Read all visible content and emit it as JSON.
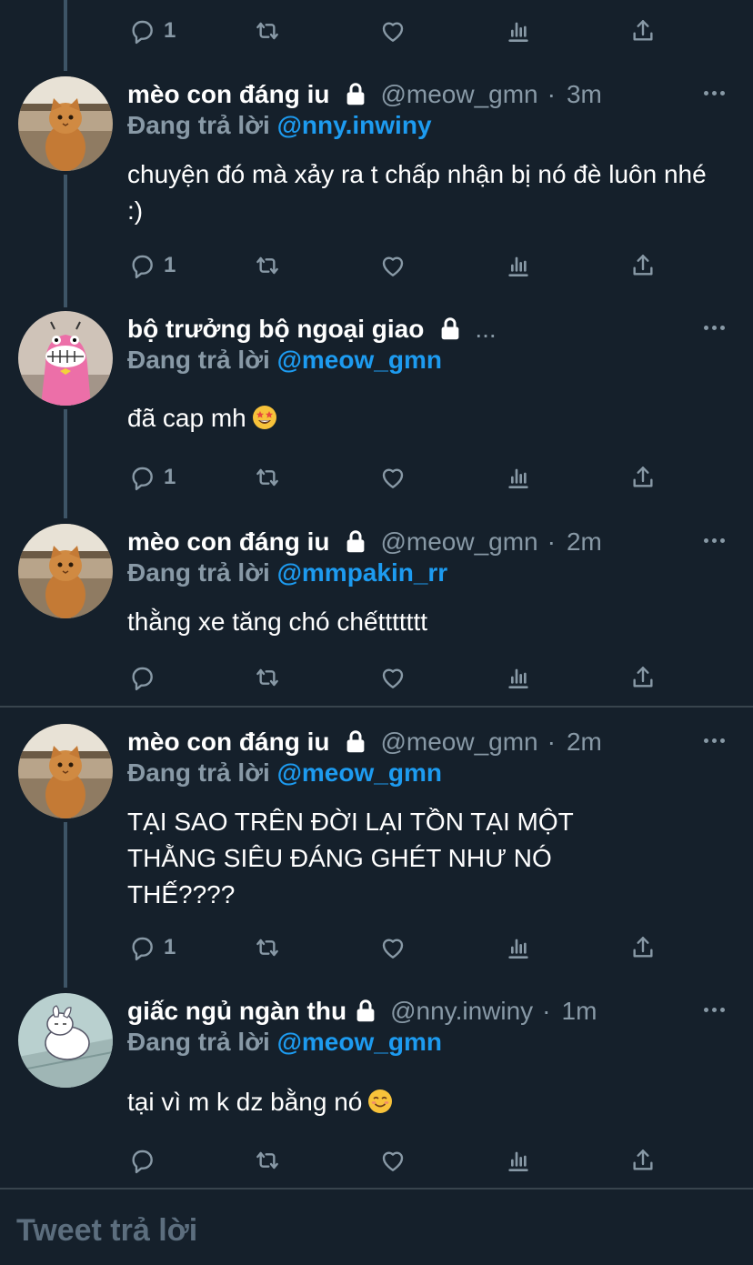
{
  "top_actions": {
    "reply_count": "1"
  },
  "tweets": [
    {
      "name": "mèo con đáng iu",
      "handle": "@meow_gmn",
      "time": "3m",
      "reply_label": "Đang trả lời",
      "reply_to": "@nny.inwiny",
      "text": "chuyện đó mà xảy ra t chấp nhận bị nó đè luôn nhé :)",
      "reply_count": "1"
    },
    {
      "name": "bộ trưởng bộ ngoại giao",
      "handle": "",
      "time": "",
      "truncated": "...",
      "reply_label": "Đang trả lời",
      "reply_to": "@meow_gmn",
      "text": "đã cap mh",
      "emoji": "star-struck-emoji",
      "reply_count": "1"
    },
    {
      "name": "mèo con đáng iu",
      "handle": "@meow_gmn",
      "time": "2m",
      "reply_label": "Đang trả lời",
      "reply_to": "@mmpakin_rr",
      "text": "thằng xe tăng chó chếttttttt",
      "reply_count": ""
    },
    {
      "name": "mèo con đáng iu",
      "handle": "@meow_gmn",
      "time": "2m",
      "reply_label": "Đang trả lời",
      "reply_to": "@meow_gmn",
      "text": "TẠI SAO TRÊN ĐỜI LẠI TỒN TẠI MỘT THẰNG SIÊU ĐÁNG GHÉT NHƯ NÓ THẾ????",
      "reply_count": "1"
    },
    {
      "name": "giấc ngủ ngàn thu",
      "handle": "@nny.inwiny",
      "time": "1m",
      "reply_label": "Đang trả lời",
      "reply_to": "@meow_gmn",
      "text": "tại vì m k dz bằng nó",
      "emoji": "smiling-face-emoji",
      "reply_count": ""
    }
  ],
  "composer": {
    "placeholder": "Tweet trả lời"
  },
  "icons": [
    "reply-icon",
    "retweet-icon",
    "like-icon",
    "analytics-icon",
    "share-icon",
    "lock-icon",
    "more-icon"
  ],
  "colors": {
    "background": "#15202b",
    "muted": "#8899a6",
    "accent": "#1d9bf0",
    "divider": "#38444d"
  }
}
